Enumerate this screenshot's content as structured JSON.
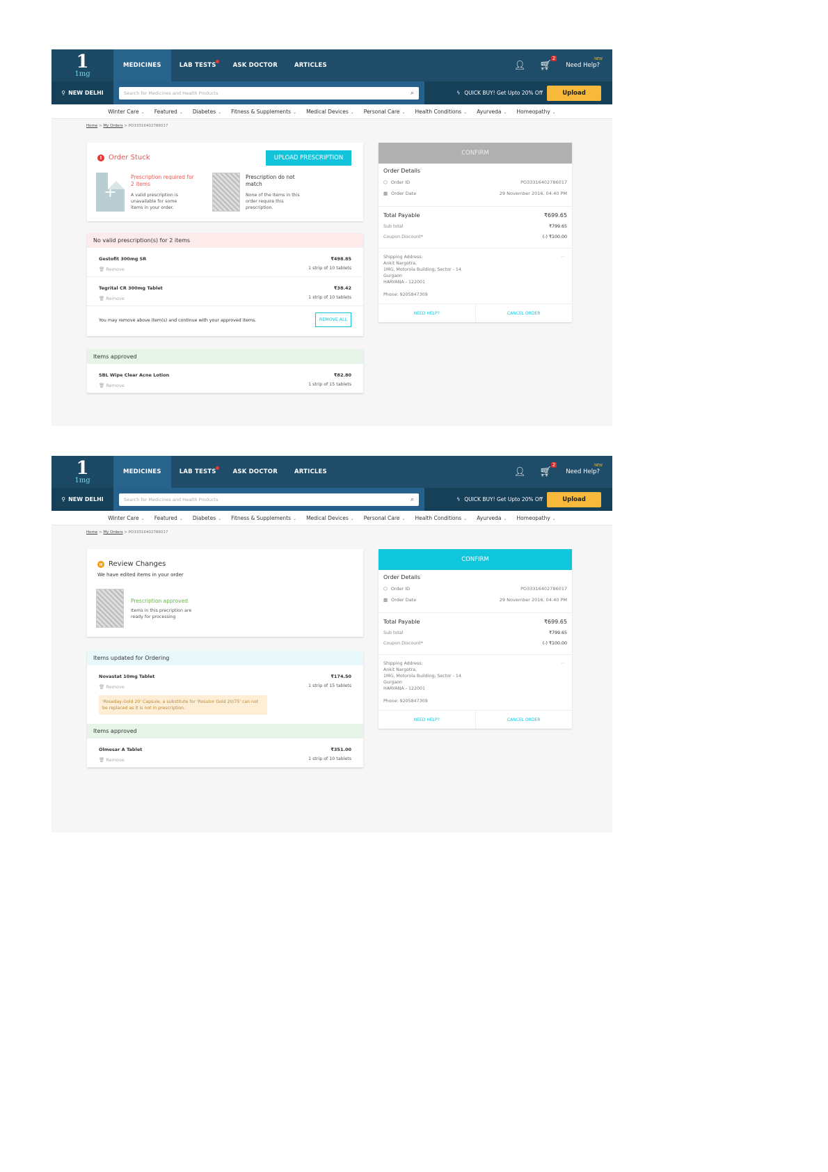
{
  "header": {
    "logo_main": "1",
    "logo_sub": "1mg",
    "tabs": [
      "MEDICINES",
      "LAB TESTS",
      "ASK DOCTOR",
      "ARTICLES"
    ],
    "cart_count": "2",
    "help": "Need Help?",
    "new_badge": "NEW",
    "location": "NEW DELHI",
    "search_placeholder": "Search for Medicines and Health Products",
    "quick_buy": "QUICK BUY! Get Upto 20% Off",
    "upload": "Upload"
  },
  "categories": [
    "Winter Care",
    "Featured",
    "Diabetes",
    "Fitness & Supplements",
    "Medical Devices",
    "Personal Care",
    "Health Conditions",
    "Ayurveda",
    "Homeopathy"
  ],
  "breadcrumb": {
    "home": "Home",
    "orders": "My Orders",
    "current": "PO33316402786017"
  },
  "order": {
    "confirm": "CONFIRM",
    "details_title": "Order Details",
    "id_label": "Order ID",
    "id": "PO33316402786017",
    "date_label": "Order Date",
    "date": "29 November 2016, 04:40 PM",
    "total_label": "Total Payable",
    "total": "₹699.65",
    "subtotal_label": "Sub total",
    "subtotal": "₹799.65",
    "coupon_label": "Coupon Discount*",
    "coupon": "(-) ₹100.00",
    "ship_label": "Shipping Address:",
    "ship_lines": [
      "Ankit Nargotra,",
      "1MG, Motorola Building, Sector - 14",
      "Gurgaon",
      "HARYANA - 122001"
    ],
    "phone": "Phone: 9205847309",
    "need_help": "NEED HELP?",
    "cancel": "CANCEL ORDER"
  },
  "screen1": {
    "status": "Order Stuck",
    "upload_btn": "UPLOAD PRESCRIPTION",
    "p1_title": "Prescription required for 2 items",
    "p1_desc": "A valid prescription is unavailable for some items in your order.",
    "p2_title": "Prescription do not match",
    "p2_desc": "None of the Items in this order require this prescription.",
    "invalid_head": "No valid prescription(s) for 2 items",
    "invalid_items": [
      {
        "name": "Gestofit 300mg SR",
        "price": "₹498.85",
        "qty": "1 strip of 10 tablets",
        "remove": "Remove"
      },
      {
        "name": "Tegrital CR 300mg Tablet",
        "price": "₹38.42",
        "qty": "1 strip of 10 tablets",
        "remove": "Remove"
      }
    ],
    "note": "You may remove above item(s) and continue with your approved items.",
    "remove_all": "REMOVE ALL",
    "approved_head": "Items approved",
    "approved_items": [
      {
        "name": "SBL Wipe Clear Acne Lotion",
        "price": "₹82.80",
        "qty": "1 strip of 15 tablets",
        "remove": "Remove"
      }
    ]
  },
  "screen2": {
    "status": "Review Changes",
    "subtitle": "We have edited items in your order",
    "p_title": "Prescription approved",
    "p_desc": "Items in this precription are ready for processing",
    "updated_head": "Items updated for Ordering",
    "updated_items": [
      {
        "name": "Novastat 10mg Tablet",
        "price": "₹174.50",
        "qty": "1 strip of 15 tablets",
        "remove": "Remove",
        "warning": "'Roseday-Gold 20' Capsule, a substitute for 'Rosutor Gold 20/75' can not be replaced as it is not in prescription."
      }
    ],
    "approved_head": "Items approved",
    "approved_items": [
      {
        "name": "Olmesar A Tablet",
        "price": "₹351.00",
        "qty": "1 strip of 10 tablets",
        "remove": "Remove"
      }
    ]
  },
  "colors": {
    "navy": "#1e4c69",
    "accent": "#11c4db",
    "upload": "#f6b93b",
    "error": "#e53935"
  }
}
